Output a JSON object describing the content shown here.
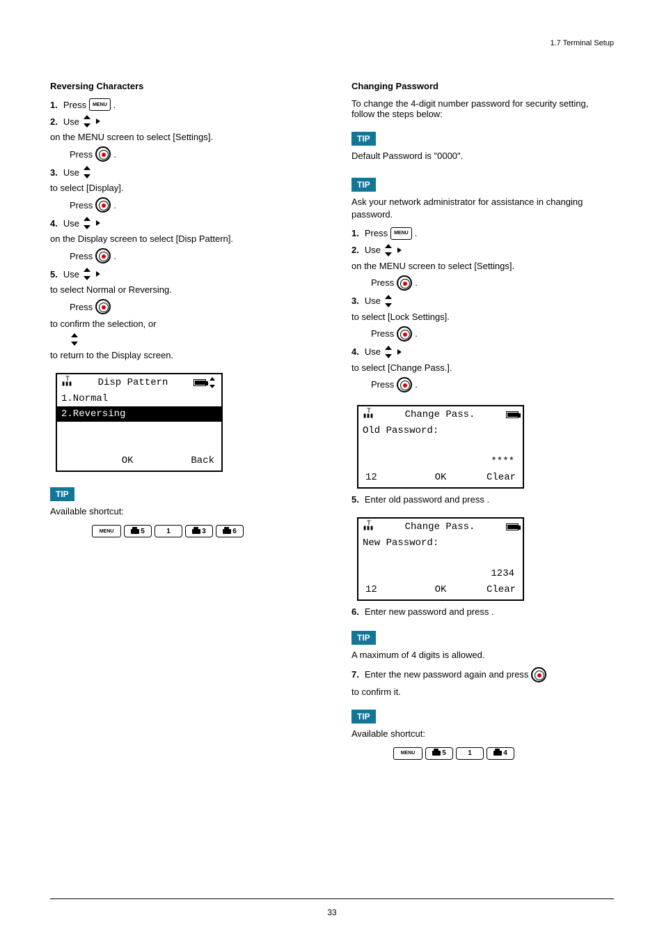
{
  "header": "1.7  Terminal Setup",
  "left": {
    "title": "Reversing Characters",
    "s2": "on the MENU screen to select [Settings].",
    "s2b": "Press",
    "s3": "to select [Display].",
    "s3b": "Press",
    "s4": "on the Display screen to select [Disp Pattern].",
    "s4b": "Press",
    "s5": "to select Normal or Reversing.",
    "press": "Press",
    "confirm_a": "to confirm the selection, or",
    "confirm_b": "to return to the Display screen.",
    "screen": {
      "title": "Disp Pattern",
      "item1": "1.Normal",
      "item2": "2.Reversing",
      "okLabel": "OK",
      "backLabel": "Back"
    },
    "tipText": "Available shortcut:",
    "shortcutDigits": [
      "5",
      "1",
      "3",
      "6"
    ]
  },
  "right": {
    "title": "Changing Password",
    "intro": "To change the 4-digit number password for security setting, follow the steps below:",
    "tip1": "Default Password  is \"0000\".",
    "tip2": "Ask your network administrator for assistance in changing password.",
    "s2": "on the MENU screen to select [Settings].",
    "s2b": "Press",
    "s3": "to select [Lock Settings].",
    "s3b": "Press",
    "s4": "to select [Change Pass.].",
    "s4b": "Press",
    "screenA": {
      "title": "Change Pass.",
      "label": "Old Password:",
      "mask": "****",
      "left": "12",
      "mid": "OK",
      "right": "Clear"
    },
    "s5": "Enter old password and press    .",
    "screenB": {
      "title": "Change Pass.",
      "label": "New Password:",
      "val": "1234",
      "left": "12",
      "mid": "OK",
      "right": "Clear"
    },
    "s6": "Enter new password and press    .",
    "tip3": "A maximum of 4 digits is allowed.",
    "s7a": "Enter the new password again and press",
    "s7b": "to confirm it.",
    "tipText": "Available shortcut:",
    "shortcutDigits": [
      "5",
      "1",
      "4"
    ]
  },
  "pageNum": "33"
}
